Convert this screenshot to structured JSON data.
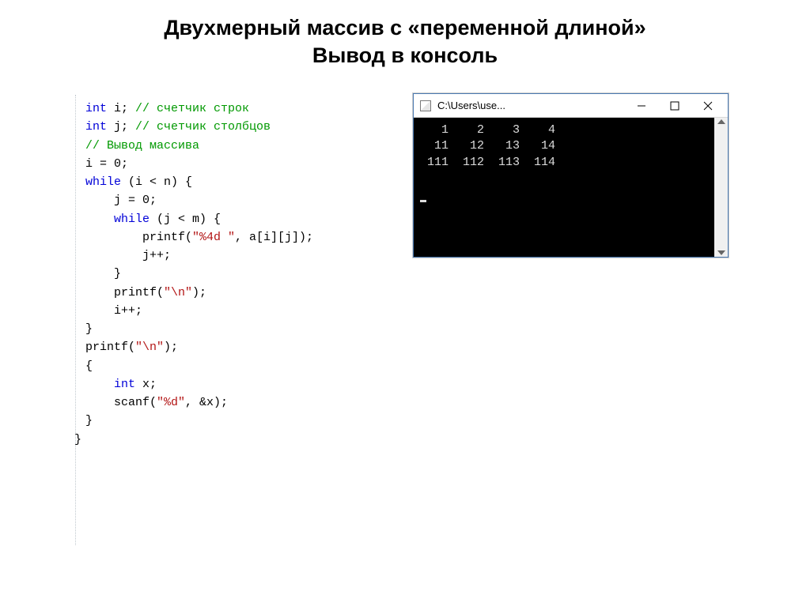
{
  "title": {
    "line1": "Двухмерный массив с «переменной длиной»",
    "line2": "Вывод в консоль"
  },
  "code": {
    "l01a": "int",
    "l01b": " i; ",
    "l01c": "// счетчик строк",
    "l02a": "int",
    "l02b": " j; ",
    "l02c": "// счетчик столбцов",
    "l03": "",
    "l04": "// Вывод массива",
    "l05": "i = 0;",
    "l06a": "while",
    "l06b": " (i < n) {",
    "l07": "    j = 0;",
    "l08a": "    ",
    "l08b": "while",
    "l08c": " (j < m) {",
    "l09a": "        printf(",
    "l09b": "\"%4d \"",
    "l09c": ", a[i][j]);",
    "l10": "        j++;",
    "l11": "    }",
    "l12a": "    printf(",
    "l12b": "\"\\n\"",
    "l12c": ");",
    "l13": "    i++;",
    "l14": "}",
    "l15a": "printf(",
    "l15b": "\"\\n\"",
    "l15c": ");",
    "l16": "",
    "l17": "{",
    "l18a": "    ",
    "l18b": "int",
    "l18c": " x;",
    "l19a": "    scanf(",
    "l19b": "\"%d\"",
    "l19c": ", &x);",
    "l20": "}"
  },
  "trailing_brace": "}",
  "console": {
    "title": "C:\\Users\\use...",
    "rows": [
      "   1    2    3    4",
      "  11   12   13   14",
      " 111  112  113  114",
      "",
      ""
    ]
  }
}
